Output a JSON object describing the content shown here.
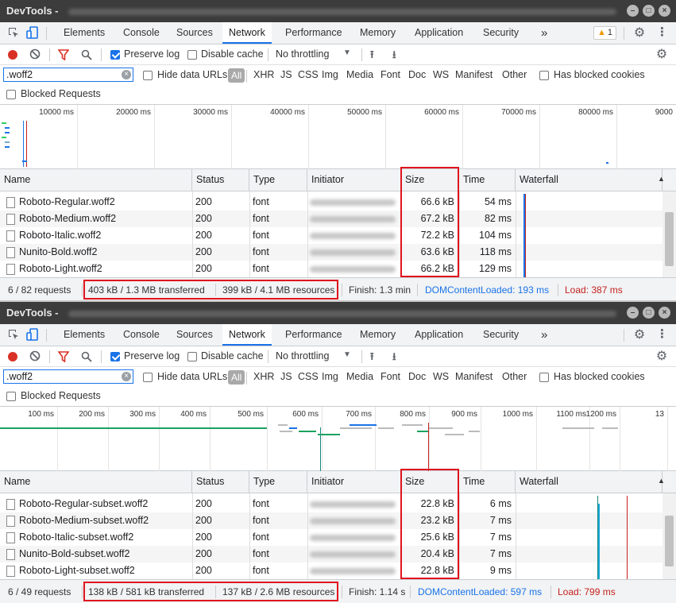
{
  "colors": {
    "accent": "#1a73e8",
    "highlight": "#e0141e",
    "dcl": "#1a73e8",
    "load": "#c5221f",
    "record": "#d93025"
  },
  "panels": [
    {
      "title": "DevTools -",
      "tabs": [
        "Elements",
        "Console",
        "Sources",
        "Network",
        "Performance",
        "Memory",
        "Application",
        "Security"
      ],
      "active_tab": "Network",
      "more_tabs": "»",
      "warning_count": "1",
      "toolbar": {
        "preserve_log": "Preserve log",
        "disable_cache": "Disable cache",
        "throttling": "No throttling"
      },
      "filter": {
        "value": ".woff2",
        "hide_data_urls": "Hide data URLs",
        "types": [
          "All",
          "XHR",
          "JS",
          "CSS",
          "Img",
          "Media",
          "Font",
          "Doc",
          "WS",
          "Manifest",
          "Other"
        ],
        "has_blocked_cookies": "Has blocked cookies",
        "blocked_requests": "Blocked Requests"
      },
      "overview": {
        "ticks": [
          "10000 ms",
          "20000 ms",
          "30000 ms",
          "40000 ms",
          "50000 ms",
          "60000 ms",
          "70000 ms",
          "80000 ms",
          "9000"
        ]
      },
      "columns": [
        "Name",
        "Status",
        "Type",
        "Initiator",
        "Size",
        "Time",
        "Waterfall"
      ],
      "rows": [
        {
          "name": "Roboto-Regular.woff2",
          "status": "200",
          "type": "font",
          "size": "66.6 kB",
          "time": "54 ms"
        },
        {
          "name": "Roboto-Medium.woff2",
          "status": "200",
          "type": "font",
          "size": "67.2 kB",
          "time": "82 ms"
        },
        {
          "name": "Roboto-Italic.woff2",
          "status": "200",
          "type": "font",
          "size": "72.2 kB",
          "time": "104 ms"
        },
        {
          "name": "Nunito-Bold.woff2",
          "status": "200",
          "type": "font",
          "size": "63.6 kB",
          "time": "118 ms"
        },
        {
          "name": "Roboto-Light.woff2",
          "status": "200",
          "type": "font",
          "size": "66.2 kB",
          "time": "129 ms"
        }
      ],
      "status": {
        "requests": "6 / 82 requests",
        "transferred": "403 kB / 1.3 MB transferred",
        "resources": "399 kB / 4.1 MB resources",
        "finish": "Finish: 1.3 min",
        "dcl": "DOMContentLoaded: 193 ms",
        "load": "Load: 387 ms"
      }
    },
    {
      "title": "DevTools -",
      "tabs": [
        "Elements",
        "Console",
        "Sources",
        "Network",
        "Performance",
        "Memory",
        "Application",
        "Security"
      ],
      "active_tab": "Network",
      "more_tabs": "»",
      "warning_count": "",
      "toolbar": {
        "preserve_log": "Preserve log",
        "disable_cache": "Disable cache",
        "throttling": "No throttling"
      },
      "filter": {
        "value": ".woff2",
        "hide_data_urls": "Hide data URLs",
        "types": [
          "All",
          "XHR",
          "JS",
          "CSS",
          "Img",
          "Media",
          "Font",
          "Doc",
          "WS",
          "Manifest",
          "Other"
        ],
        "has_blocked_cookies": "Has blocked cookies",
        "blocked_requests": "Blocked Requests"
      },
      "overview": {
        "ticks": [
          "100 ms",
          "200 ms",
          "300 ms",
          "400 ms",
          "500 ms",
          "600 ms",
          "700 ms",
          "800 ms",
          "900 ms",
          "1000 ms",
          "1100 ms",
          "1200 ms",
          "13"
        ]
      },
      "columns": [
        "Name",
        "Status",
        "Type",
        "Initiator",
        "Size",
        "Time",
        "Waterfall"
      ],
      "rows": [
        {
          "name": "Roboto-Regular-subset.woff2",
          "status": "200",
          "type": "font",
          "size": "22.8 kB",
          "time": "6 ms"
        },
        {
          "name": "Roboto-Medium-subset.woff2",
          "status": "200",
          "type": "font",
          "size": "23.2 kB",
          "time": "7 ms"
        },
        {
          "name": "Roboto-Italic-subset.woff2",
          "status": "200",
          "type": "font",
          "size": "25.6 kB",
          "time": "7 ms"
        },
        {
          "name": "Nunito-Bold-subset.woff2",
          "status": "200",
          "type": "font",
          "size": "20.4 kB",
          "time": "7 ms"
        },
        {
          "name": "Roboto-Light-subset.woff2",
          "status": "200",
          "type": "font",
          "size": "22.8 kB",
          "time": "9 ms"
        }
      ],
      "status": {
        "requests": "6 / 49 requests",
        "transferred": "138 kB / 581 kB transferred",
        "resources": "137 kB / 2.6 MB resources",
        "finish": "Finish: 1.14 s",
        "dcl": "DOMContentLoaded: 597 ms",
        "load": "Load: 799 ms"
      }
    }
  ]
}
